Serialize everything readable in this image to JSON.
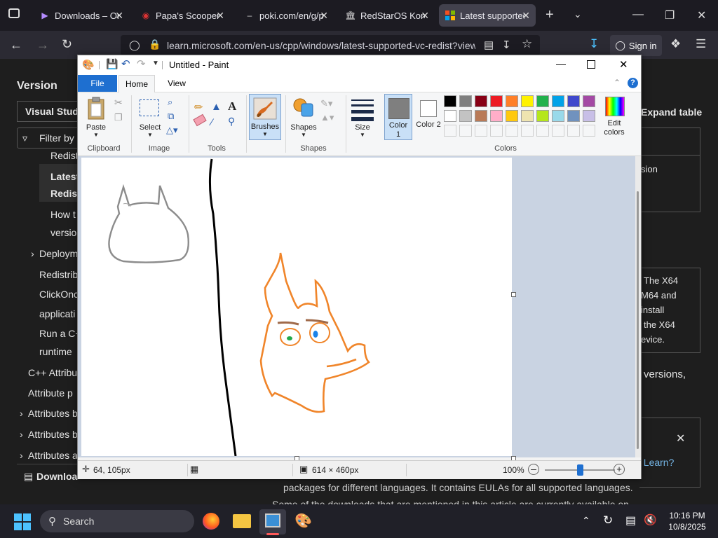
{
  "browser": {
    "tabs": [
      {
        "title": "Downloads – On",
        "icon": "vs-icon"
      },
      {
        "title": "Papa's Scooperi",
        "icon": "game-icon"
      },
      {
        "title": "poki.com/en/g/p",
        "icon": "page-icon"
      },
      {
        "title": "RedStarOS Korea",
        "icon": "bank-icon"
      },
      {
        "title": "Latest supported",
        "icon": "microsoft-icon"
      }
    ],
    "url": "learn.microsoft.com/en-us/cpp/windows/latest-supported-vc-redist?view",
    "signin_label": "Sign in"
  },
  "doc": {
    "sidebar_heading": "Version",
    "version_select": "Visual Studi",
    "filter_label": "Filter by",
    "nav_items": [
      "Redist",
      "Latest",
      "Redist",
      "How t",
      "versio",
      "Deploym",
      "Redistrib",
      "ClickOnc",
      "applicati",
      "Run a C+",
      "runtime",
      "C++ Attribu",
      "Attribute p",
      "Attributes b",
      "Attributes b",
      "Attributes a"
    ],
    "download_pdf": "Download PDF",
    "expand_table": "Expand table",
    "right_snippets": [
      "sion",
      "The X64",
      "M64 and",
      "install",
      "the X64",
      "evice.",
      "versions,",
      "t Learn?"
    ],
    "bottom_lines": [
      "packages for different languages. It contains EULAs for all supported languages.",
      "Some of the downloads that are mentioned in this article are currently available on"
    ]
  },
  "paint": {
    "title": "Untitled - Paint",
    "tabs": [
      "File",
      "Home",
      "View"
    ],
    "groups": {
      "clipboard": "Clipboard",
      "image": "Image",
      "tools": "Tools",
      "shapes": "Shapes",
      "colors": "Colors"
    },
    "buttons": {
      "paste": "Paste",
      "select": "Select",
      "brushes": "Brushes",
      "shapes": "Shapes",
      "size": "Size",
      "color1": "Color 1",
      "color2": "Color 2",
      "edit_colors": "Edit colors"
    },
    "palette_row1": [
      "#000000",
      "#7f7f7f",
      "#880015",
      "#ed1c24",
      "#ff7f27",
      "#fff200",
      "#22b14c",
      "#00a2e8",
      "#3f48cc",
      "#a349a4"
    ],
    "palette_row2": [
      "#ffffff",
      "#c3c3c3",
      "#b97a57",
      "#ffaec9",
      "#ffc90e",
      "#efe4b0",
      "#b5e61d",
      "#99d9ea",
      "#7092be",
      "#c8bfe7"
    ],
    "color1": "#7f7f7f",
    "color2": "#ffffff",
    "status": {
      "cursor_pos": "64, 105px",
      "canvas_size": "614 × 460px",
      "zoom": "100%"
    },
    "zoom_level": 0.5
  },
  "taskbar": {
    "search_label": "Search",
    "time": "10:16 PM",
    "date": "10/8/2025"
  }
}
